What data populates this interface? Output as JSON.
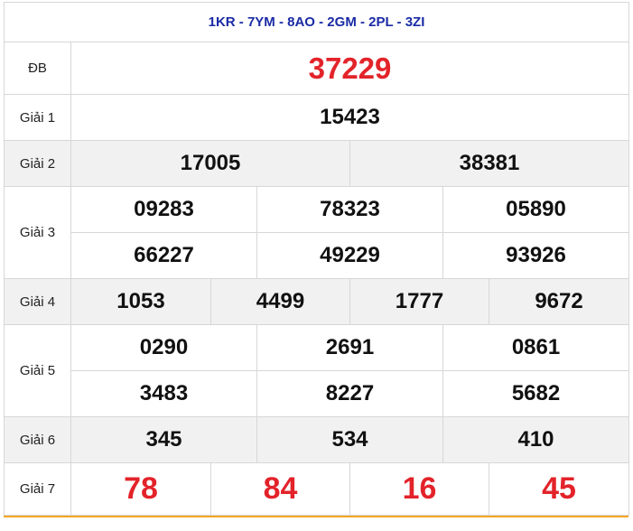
{
  "header": {
    "codes": "1KR - 7YM - 8AO - 2GM - 2PL - 3ZI"
  },
  "prizes": {
    "db": {
      "label": "ĐB",
      "numbers": [
        "37229"
      ]
    },
    "g1": {
      "label": "Giải 1",
      "numbers": [
        "15423"
      ]
    },
    "g2": {
      "label": "Giải 2",
      "numbers": [
        "17005",
        "38381"
      ]
    },
    "g3": {
      "label": "Giải 3",
      "numbers": [
        "09283",
        "78323",
        "05890",
        "66227",
        "49229",
        "93926"
      ]
    },
    "g4": {
      "label": "Giải 4",
      "numbers": [
        "1053",
        "4499",
        "1777",
        "9672"
      ]
    },
    "g5": {
      "label": "Giải 5",
      "numbers": [
        "0290",
        "2691",
        "0861",
        "3483",
        "8227",
        "5682"
      ]
    },
    "g6": {
      "label": "Giải 6",
      "numbers": [
        "345",
        "534",
        "410"
      ]
    },
    "g7": {
      "label": "Giải 7",
      "numbers": [
        "78",
        "84",
        "16",
        "45"
      ]
    }
  },
  "colors": {
    "header_text": "#1a2ba5",
    "special_number": "#e3232a",
    "border": "#d7d7d7",
    "shade": "#f1f1f1",
    "accent_line": "#f3a623"
  }
}
